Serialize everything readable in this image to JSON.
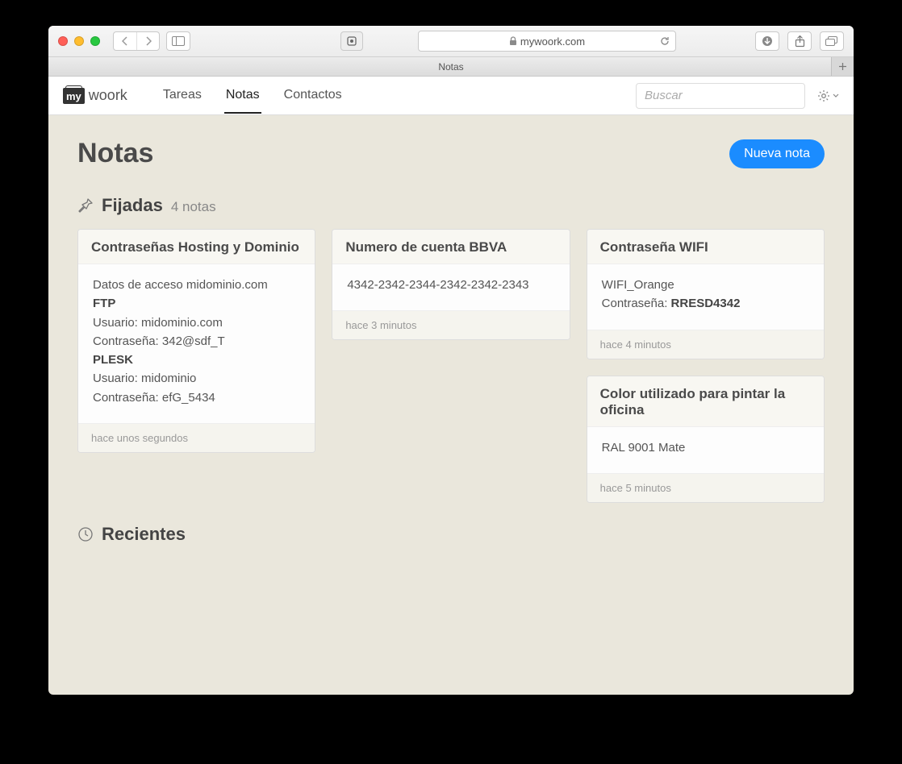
{
  "browser": {
    "url": "mywoork.com",
    "tab_title": "Notas"
  },
  "nav": {
    "logo_box": "my",
    "logo_text": "woork",
    "links": [
      {
        "label": "Tareas",
        "active": false
      },
      {
        "label": "Notas",
        "active": true
      },
      {
        "label": "Contactos",
        "active": false
      }
    ],
    "search_placeholder": "Buscar"
  },
  "page": {
    "title": "Notas",
    "new_note_label": "Nueva nota"
  },
  "pinned": {
    "title": "Fijadas",
    "count_label": "4 notas",
    "notes": [
      {
        "title": "Contraseñas Hosting y Dominio",
        "body_lines": [
          {
            "text": "Datos de acceso midominio.com",
            "bold": false
          },
          {
            "text": "FTP",
            "bold": true
          },
          {
            "text": "Usuario: midominio.com",
            "bold": false
          },
          {
            "text": "Contraseña: 342@sdf_T",
            "bold": false
          },
          {
            "text": "PLESK",
            "bold": true
          },
          {
            "text": "Usuario: midominio",
            "bold": false
          },
          {
            "text": "Contraseña: efG_5434",
            "bold": false
          }
        ],
        "footer": "hace unos segundos"
      },
      {
        "title": "Numero de cuenta BBVA",
        "body_lines": [
          {
            "text": "4342-2342-2344-2342-2342-2343",
            "bold": false
          }
        ],
        "footer": "hace 3 minutos"
      },
      {
        "title": "Contraseña WIFI",
        "body_lines_mixed": [
          {
            "prefix": "",
            "bold_part": "",
            "text": "WIFI_Orange"
          },
          {
            "prefix": "Contraseña: ",
            "bold_part": "RRESD4342",
            "text": ""
          }
        ],
        "footer": "hace 4 minutos"
      },
      {
        "title": "Color utilizado para pintar la oficina",
        "body_lines": [
          {
            "text": "RAL 9001 Mate",
            "bold": false
          }
        ],
        "footer": "hace 5 minutos"
      }
    ]
  },
  "recent": {
    "title": "Recientes"
  }
}
